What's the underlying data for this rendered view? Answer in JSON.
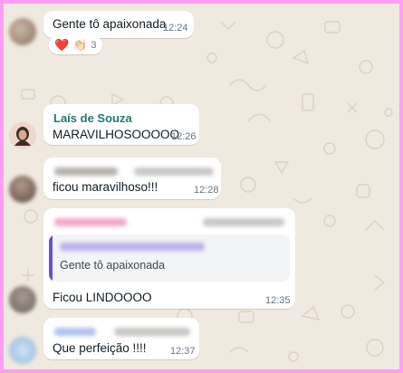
{
  "messages": [
    {
      "text": "Gente tô apaixonada",
      "time": "12:24"
    },
    {
      "sender": "Laís de Souza",
      "text": "MARAVILHOSOOOOO",
      "time": "12:26"
    },
    {
      "text": "ficou maravilhoso!!!",
      "time": "12:28"
    },
    {
      "quote_text": "Gente tô apaixonada",
      "text": "Ficou LINDOOOO",
      "time": "12:35"
    },
    {
      "text": "Que perfeição !!!!",
      "time": "12:37"
    }
  ],
  "reactions": {
    "emoji_1": "❤️",
    "emoji_2": "👏🏻",
    "count": "3"
  },
  "colors": {
    "frame": "#ff9ef2",
    "wallpaper": "#efe9e0",
    "sender_name": "#1f7c6c",
    "quote_bar": "#6a4fd8",
    "timestamp": "#667781"
  }
}
